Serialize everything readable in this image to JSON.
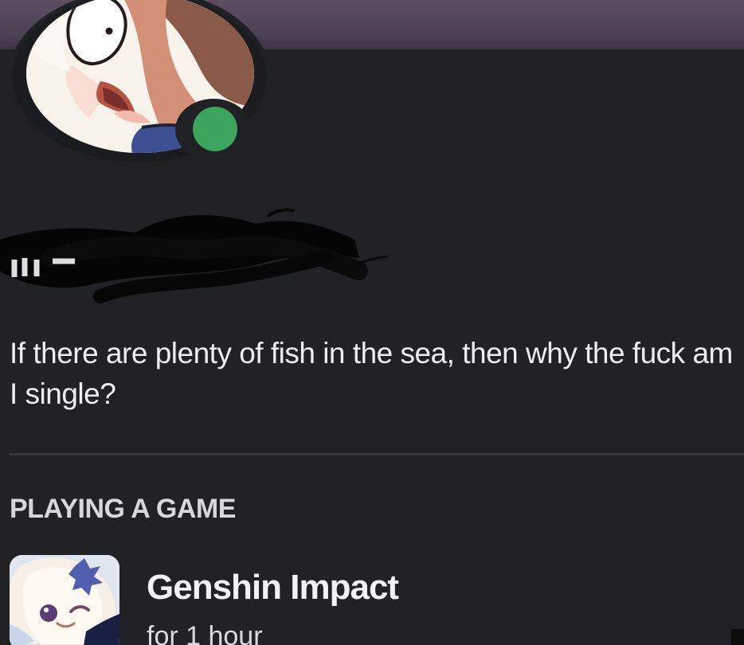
{
  "profile": {
    "status": "online",
    "status_color": "#3ba55d",
    "username_redacted": true
  },
  "about_me": {
    "text": "If there are plenty of fish in the sea, then why the fuck am I single?"
  },
  "activity": {
    "heading": "PLAYING A GAME",
    "game_title": "Genshin Impact",
    "duration": "for 1 hour"
  },
  "theme": {
    "banner": "#5e4d63",
    "panel": "#202225",
    "divider": "#34373c"
  },
  "icons": {
    "avatar": "avatar-image",
    "status": "online-status-icon",
    "game": "genshin-game-icon"
  }
}
